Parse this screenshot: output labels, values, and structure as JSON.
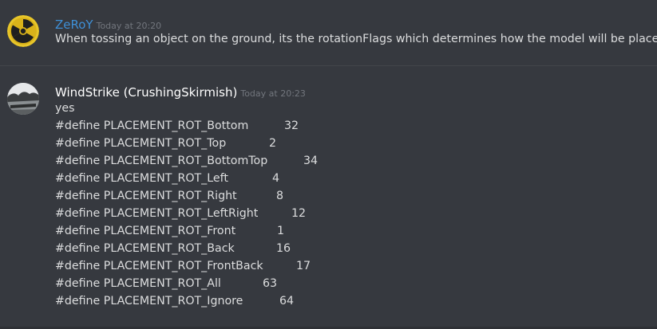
{
  "messages": [
    {
      "author": "ZeRoY",
      "author_color": "#3e8fd6",
      "timestamp": "Today at 20:20",
      "avatar": "radiation-icon",
      "lines": [
        "When tossing an object on the ground, its the rotationFlags which determines how the model will be placed?"
      ]
    },
    {
      "author": "WindStrike (CrushingSkirmish)",
      "author_color": "#ffffff",
      "timestamp": "Today at 20:23",
      "avatar": "landscape-photo-avatar",
      "intro": "yes",
      "defines": [
        {
          "name": "#define PLACEMENT_ROT_Bottom",
          "value": "32"
        },
        {
          "name": "#define PLACEMENT_ROT_Top",
          "value": "2"
        },
        {
          "name": "#define PLACEMENT_ROT_BottomTop",
          "value": "34"
        },
        {
          "name": "#define PLACEMENT_ROT_Left",
          "value": "4"
        },
        {
          "name": "#define PLACEMENT_ROT_Right",
          "value": "8"
        },
        {
          "name": "#define PLACEMENT_ROT_LeftRight",
          "value": "12"
        },
        {
          "name": "#define PLACEMENT_ROT_Front",
          "value": "1"
        },
        {
          "name": "#define PLACEMENT_ROT_Back",
          "value": "16"
        },
        {
          "name": "#define PLACEMENT_ROT_FrontBack",
          "value": "17"
        },
        {
          "name": "#define PLACEMENT_ROT_All",
          "value": "63"
        },
        {
          "name": "#define PLACEMENT_ROT_Ignore",
          "value": "64"
        }
      ]
    }
  ]
}
